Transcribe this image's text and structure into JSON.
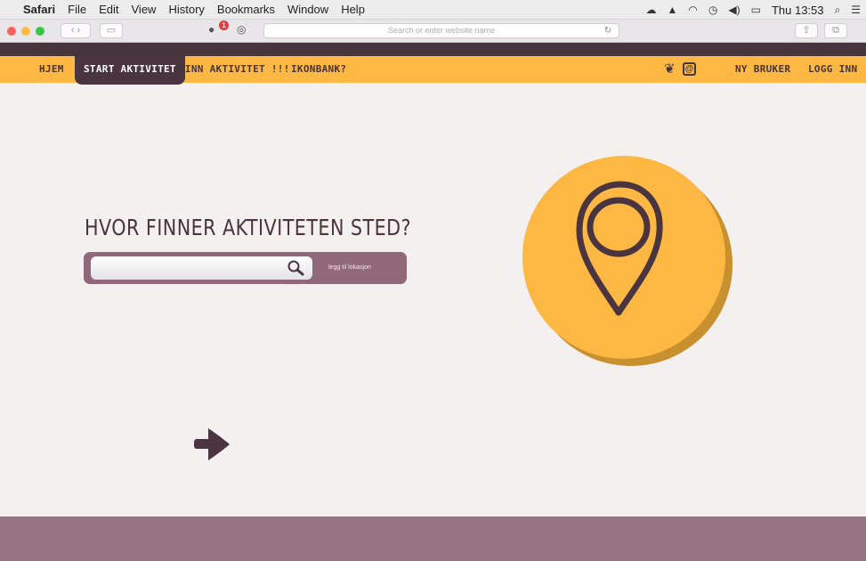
{
  "menubar": {
    "app": "Safari",
    "items": [
      "File",
      "Edit",
      "View",
      "History",
      "Bookmarks",
      "Window",
      "Help"
    ],
    "clock": "Thu 13:53",
    "battery_icon": "battery-icon",
    "wifi_icon": "wifi-icon"
  },
  "browser": {
    "address_placeholder": "Search or enter website name",
    "extension_badge": "1"
  },
  "nav": {
    "items": [
      {
        "label": "HJEM"
      },
      {
        "label": "START AKTIVITET",
        "active": true
      },
      {
        "label": "FINN AKTIVITET !!!"
      },
      {
        "label": "IKONBANK?"
      }
    ],
    "right_items": [
      {
        "label": "NY BRUKER"
      },
      {
        "label": "LOGG INN"
      }
    ],
    "social": [
      "twitter-icon",
      "instagram-icon"
    ]
  },
  "main": {
    "heading": "HVOR FINNER AKTIVITETEN STED?",
    "search_value": "",
    "add_location_label": "legg til lokasjon"
  },
  "colors": {
    "nav_bg": "#fcb843",
    "dark": "#4a3440",
    "search_bar": "#916877",
    "page_bg": "#f3f0ef",
    "footer": "#947581",
    "circle": "#fcb843",
    "circle_shadow": "#c8902f"
  }
}
